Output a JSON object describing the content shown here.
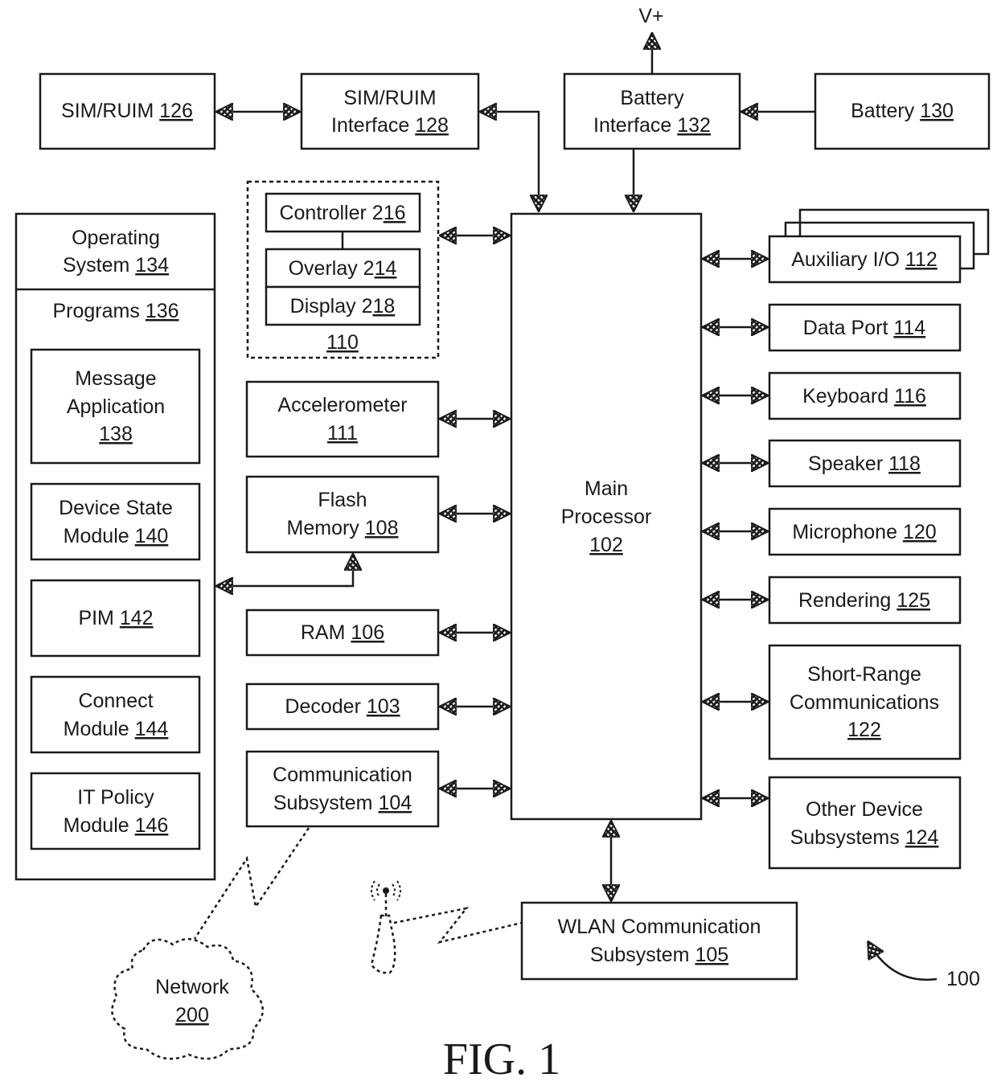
{
  "figure": {
    "caption": "FIG. 1",
    "reference": "100",
    "voltage_label": "V+"
  },
  "blocks": {
    "sim_ruim": {
      "name": "SIM/RUIM",
      "ref": "126"
    },
    "sim_ruim_interface": {
      "line1": "SIM/RUIM",
      "line2": "Interface",
      "ref": "128"
    },
    "battery_interface": {
      "line1": "Battery",
      "line2": "Interface",
      "ref": "132"
    },
    "battery": {
      "name": "Battery",
      "ref": "130"
    },
    "operating_system": {
      "line1": "Operating",
      "line2": "System",
      "ref": "134"
    },
    "programs": {
      "name": "Programs",
      "ref": "136"
    },
    "message_application": {
      "line1": "Message",
      "line2": "Application",
      "ref": "138"
    },
    "device_state_module": {
      "line1": "Device State",
      "line2": "Module",
      "ref": "140"
    },
    "pim": {
      "name": "PIM",
      "ref": "142"
    },
    "connect_module": {
      "line1": "Connect",
      "line2": "Module",
      "ref": "144"
    },
    "it_policy_module": {
      "line1": "IT Policy",
      "line2": "Module",
      "ref": "146"
    },
    "controller": {
      "name": "Controller 2",
      "ref": "16"
    },
    "overlay": {
      "name": "Overlay 2",
      "ref": "14"
    },
    "display": {
      "name": "Display 2",
      "ref": "18"
    },
    "display_group": {
      "ref": "110"
    },
    "accelerometer": {
      "line1": "Accelerometer",
      "ref": "111"
    },
    "flash_memory": {
      "line1": "Flash",
      "line2": "Memory",
      "ref": "108"
    },
    "ram": {
      "name": "RAM",
      "ref": "106"
    },
    "decoder": {
      "name": "Decoder",
      "ref": "103"
    },
    "communication_subsystem": {
      "line1": "Communication",
      "line2": "Subsystem",
      "ref": "104"
    },
    "main_processor": {
      "line1": "Main",
      "line2": "Processor",
      "ref": "102"
    },
    "auxiliary_io": {
      "name": "Auxiliary I/O",
      "ref": "112"
    },
    "data_port": {
      "name": "Data Port",
      "ref": "114"
    },
    "keyboard": {
      "name": "Keyboard",
      "ref": "116"
    },
    "speaker": {
      "name": "Speaker",
      "ref": "118"
    },
    "microphone": {
      "name": "Microphone",
      "ref": "120"
    },
    "rendering": {
      "name": "Rendering",
      "ref": "125"
    },
    "short_range": {
      "line1": "Short-Range",
      "line2": "Communications",
      "ref": "122"
    },
    "other_device": {
      "line1": "Other Device",
      "line2": "Subsystems",
      "ref": "124"
    },
    "wlan": {
      "line1": "WLAN Communication",
      "line2": "Subsystem",
      "ref": "105"
    },
    "network": {
      "line1": "Network",
      "ref": "200"
    }
  }
}
